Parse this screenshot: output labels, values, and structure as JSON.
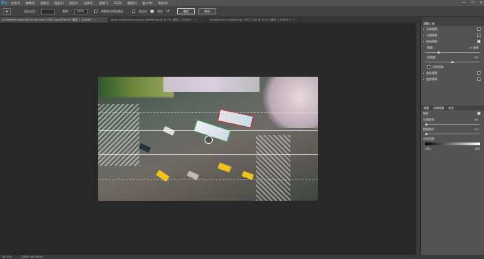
{
  "app": {
    "logo": "Ps"
  },
  "menu": {
    "items": [
      "文件(F)",
      "编辑(E)",
      "图像(I)",
      "图层(L)",
      "类型(Y)",
      "选择(S)",
      "滤镜(T)",
      "3D(D)",
      "视图(V)",
      "窗口(W)",
      "帮助(H)"
    ]
  },
  "window_controls": {
    "minimize": "—",
    "restore": "❐",
    "close": "✕"
  },
  "options": {
    "tool_icon": "tilt-shift-icon",
    "selection_label": "选区出血：",
    "focus_label": "聚焦：",
    "focus_value": "100%",
    "save_mask_label": "将蒙版存储到通道",
    "hq_label": "高品质",
    "preview_label": "预览",
    "ok_label": "确定",
    "cancel_label": "取消"
  },
  "tabs": [
    {
      "title": "architecture-asian-bird-s-eye-view-108527.jpg @ 44.4% (图层 1, RGB/8) *",
      "active": true
    },
    {
      "title": "aerial-architecture-blue-sky-466685.jpg @ 16.7% (图层 1, RGB/8) *",
      "active": false
    },
    {
      "title": "architecture-buildings-city-138077.jpg @ 33.3% (图层 1, RGB/8) *",
      "active": false
    }
  ],
  "status": {
    "zoom": "44.37%",
    "doc": "文档:6.18M/16.5M"
  },
  "panel": {
    "title_tabs": [
      "模糊工具"
    ],
    "blur_rows": [
      {
        "label": "场景模糊",
        "checked": false
      },
      {
        "label": "光圈模糊",
        "checked": false
      },
      {
        "label": "移轴模糊",
        "checked": true
      }
    ],
    "blur_label": "模糊：",
    "blur_value": "15 像素",
    "distortion_label": "扭曲度：",
    "distortion_value": "0%",
    "symmetric_label": "对称扭曲",
    "extra_rows": [
      {
        "label": "路径模糊",
        "checked": false
      },
      {
        "label": "旋转模糊",
        "checked": false
      }
    ],
    "effects_tabs": [
      "效果",
      "动感效果",
      "杂色"
    ],
    "bokeh_label": "散景",
    "bokeh_checked": true,
    "light_bokeh_label": "光源散景：",
    "light_bokeh_value": "0%",
    "bokeh_color_label": "散景颜色：",
    "bokeh_color_value": "0%",
    "light_range_label": "光照范围：",
    "range_low": "191",
    "range_high": "255"
  },
  "colors": {
    "menubar": "#535353",
    "panel": "#535353",
    "canvas": "#282828",
    "accent": "#31a8ff"
  }
}
